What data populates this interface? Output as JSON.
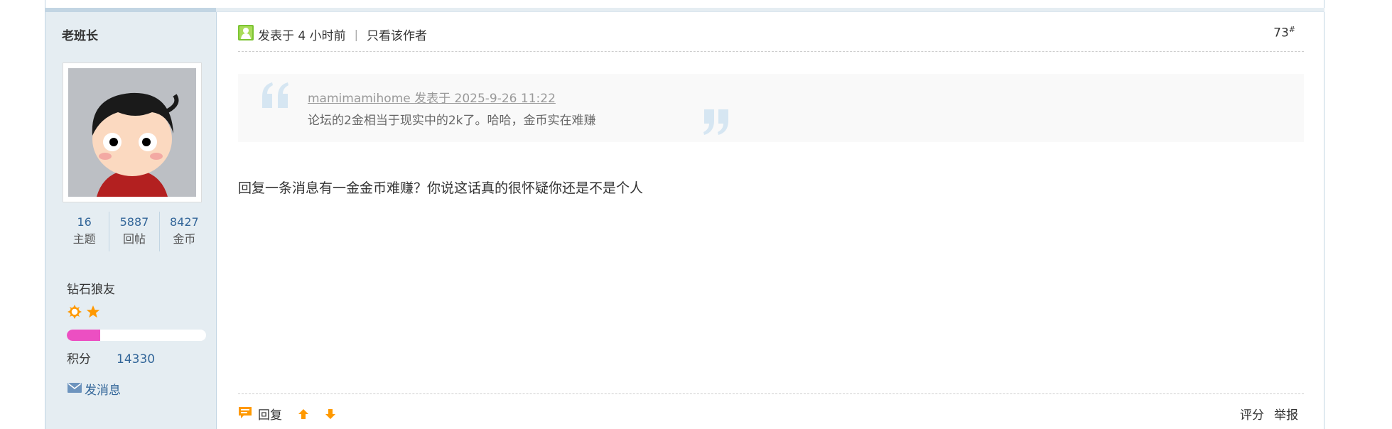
{
  "author": {
    "name": "老班长",
    "stats": [
      {
        "value": "16",
        "label": "主题"
      },
      {
        "value": "5887",
        "label": "回帖"
      },
      {
        "value": "8427",
        "label": "金币"
      }
    ],
    "rank": "钻石狼友",
    "rank_icons": [
      "sun-icon",
      "star-icon"
    ],
    "level_progress": 0.24,
    "points_label": "积分",
    "points_value": "14330",
    "message_label": "发消息"
  },
  "post": {
    "time_text": "发表于 4 小时前",
    "separator": "|",
    "only_author_label": "只看该作者",
    "floor_number": "73",
    "floor_mark": "#",
    "quote": {
      "meta": "mamimamihome 发表于 2025-9-26 11:22",
      "text": "论坛的2金相当于现实中的2k了。哈哈，金币实在难赚"
    },
    "content": "回复一条消息有一金金币难赚？你说这话真的很怀疑你还是不是个人"
  },
  "footer": {
    "reply_label": "回复",
    "rate_label": "评分",
    "report_label": "举报"
  },
  "colors": {
    "sidebar_bg": "#e5edf2",
    "link_blue": "#336699",
    "progress_fill": "#ec4fc2",
    "icon_orange": "#ff9900",
    "quote_bg": "#f9f9f9"
  }
}
